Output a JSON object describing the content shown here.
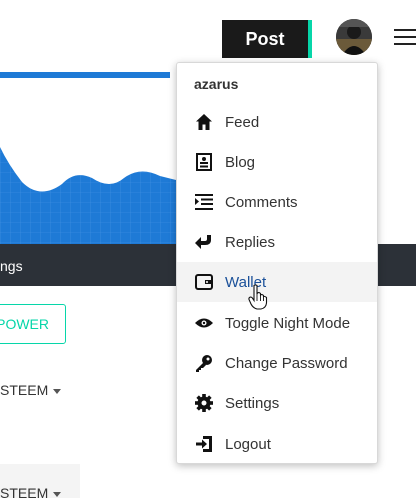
{
  "header": {
    "post_label": "Post",
    "avatar_icon": "user-avatar",
    "menu_icon": "hamburger-icon"
  },
  "nav": {
    "partial_label": "ngs"
  },
  "content": {
    "power_button_label": "POWER",
    "currency_1": "STEEM",
    "currency_2": "STEEM"
  },
  "user_menu": {
    "username": "azarus",
    "items": [
      {
        "label": "Feed",
        "icon": "home-icon"
      },
      {
        "label": "Blog",
        "icon": "blog-icon"
      },
      {
        "label": "Comments",
        "icon": "comments-icon"
      },
      {
        "label": "Replies",
        "icon": "reply-icon"
      },
      {
        "label": "Wallet",
        "icon": "wallet-icon"
      },
      {
        "label": "Toggle Night Mode",
        "icon": "eye-icon"
      },
      {
        "label": "Change Password",
        "icon": "key-icon"
      },
      {
        "label": "Settings",
        "icon": "gear-icon"
      },
      {
        "label": "Logout",
        "icon": "logout-icon"
      }
    ],
    "hovered_item": "Wallet"
  },
  "colors": {
    "accent": "#06d6a9",
    "banner_blue": "#1e7ad6",
    "dark_bar": "#2c3138",
    "link_blue": "#1a5099"
  }
}
